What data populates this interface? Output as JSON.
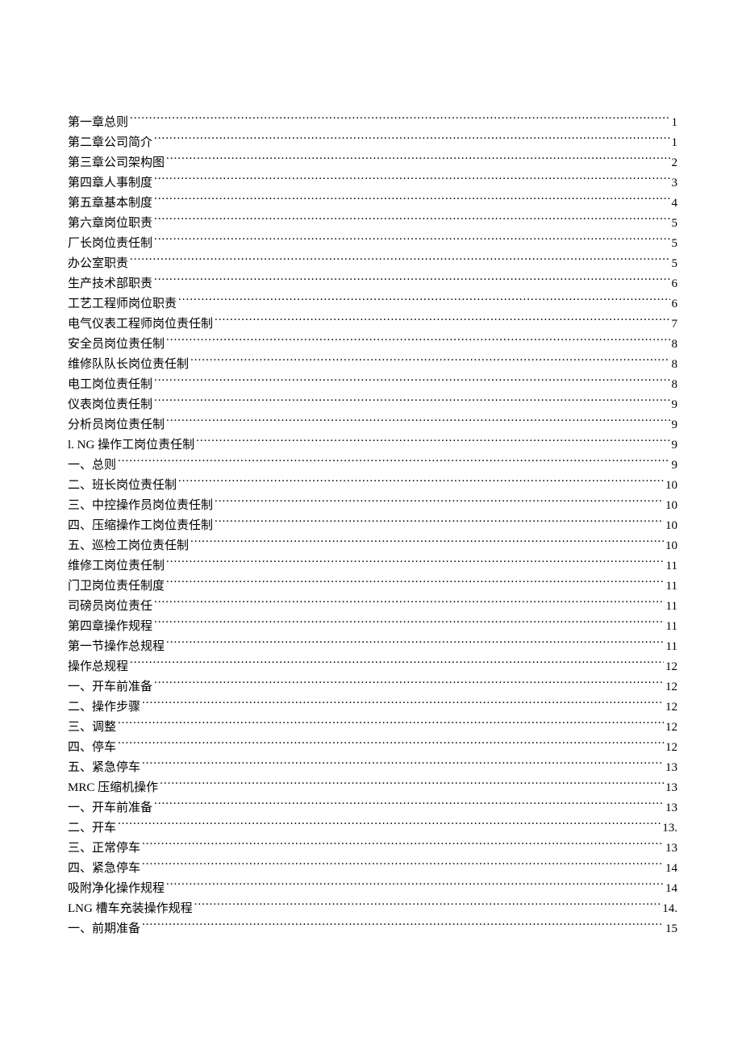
{
  "toc": [
    {
      "title": "第一章总则",
      "page": "1"
    },
    {
      "title": "第二章公司简介",
      "page": "1"
    },
    {
      "title": "第三章公司架构图",
      "page": "2"
    },
    {
      "title": "第四章人事制度",
      "page": "3"
    },
    {
      "title": "第五章基本制度",
      "page": "4"
    },
    {
      "title": "第六章岗位职责",
      "page": "5"
    },
    {
      "title": "厂长岗位责任制",
      "page": "5"
    },
    {
      "title": "办公室职责",
      "page": "5"
    },
    {
      "title": "生产技术部职责",
      "page": "6"
    },
    {
      "title": "工艺工程师岗位职责",
      "page": "6"
    },
    {
      "title": "电气仪表工程师岗位责任制",
      "page": "7"
    },
    {
      "title": "安全员岗位责任制",
      "page": "8"
    },
    {
      "title": "维修队队长岗位责任制",
      "page": "8"
    },
    {
      "title": "电工岗位责任制",
      "page": "8"
    },
    {
      "title": "仪表岗位责任制",
      "page": "9"
    },
    {
      "title": "分析员岗位责任制",
      "page": "9"
    },
    {
      "title": "l. NG 操作工岗位责任制",
      "page": "9"
    },
    {
      "title": "一、总则",
      "page": "9"
    },
    {
      "title": "二、班长岗位责任制",
      "page": "10"
    },
    {
      "title": "三、中控操作员岗位责任制",
      "page": "10"
    },
    {
      "title": "四、压缩操作工岗位责任制",
      "page": "10"
    },
    {
      "title": "五、巡检工岗位责任制",
      "page": "10"
    },
    {
      "title": "维修工岗位责任制",
      "page": "11"
    },
    {
      "title": "门卫岗位责任制度",
      "page": "11"
    },
    {
      "title": "司磅员岗位责任",
      "page": "11"
    },
    {
      "title": "第四章操作规程",
      "page": "11"
    },
    {
      "title": "第一节操作总规程",
      "page": "11"
    },
    {
      "title": "操作总规程",
      "page": "12"
    },
    {
      "title": "一、开车前准备",
      "page": "12"
    },
    {
      "title": "二、操作步骤",
      "page": "12"
    },
    {
      "title": "三、调整",
      "page": "12"
    },
    {
      "title": "四、停车",
      "page": "12"
    },
    {
      "title": "五、紧急停车",
      "page": "13"
    },
    {
      "title": "MRC 压缩机操作",
      "page": "13"
    },
    {
      "title": "一、开车前准备",
      "page": "13"
    },
    {
      "title": "二、开车",
      "page": "13."
    },
    {
      "title": "三、正常停车",
      "page": "13"
    },
    {
      "title": "四、紧急停车",
      "page": "14"
    },
    {
      "title": "吸附净化操作规程",
      "page": "14"
    },
    {
      "title": "LNG 槽车充装操作规程",
      "page": "14."
    },
    {
      "title": "一、前期准备",
      "page": "15"
    }
  ]
}
